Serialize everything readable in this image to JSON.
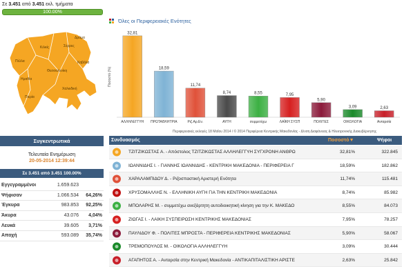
{
  "header": {
    "counted_prefix": "Σε",
    "counted": "3.451",
    "counted_mid": "από",
    "total": "3.451",
    "counted_suffix": "εκλ. τμήματα",
    "progress_label": "100.00%",
    "progress": 1.0
  },
  "map": {
    "labels": [
      "Σέρρες",
      "Κιλκίς",
      "Πέλλα",
      "Δράμα",
      "Θεσσαλονίκη",
      "Ημαθία",
      "Καβάλα",
      "Πιερία",
      "Χαλκιδική"
    ]
  },
  "chart": {
    "title": "Όλες οι Περιφερειακές Ενότητες",
    "footnote": "Περιφερειακές εκλογές 18 Μαΐου 2014 / © 2014 Περιφέρεια Κεντρικής Μακεδονίας - Δ/νση Διαφάνειας & Ηλεκτρονικής Διακυβέρνησης"
  },
  "chart_data": {
    "type": "bar",
    "ylabel": "Ποσοστό (%)",
    "categories": [
      "ΑΛΛΗΛΕΓΓΥΗ",
      "ΠΡΩΤΑΘΛΗΤΡΙΑ",
      "Ριζ.Αρ.Εν.",
      "ΑΥΓΗ",
      "συμμετέχω",
      "ΛΑΪΚΗ ΣΥΣΠ",
      "ΠΟΛΙΤΕΣ",
      "ΟΙΚΟΛΟΓΙΑ",
      "Ανταρσία"
    ],
    "values": [
      32.81,
      18.59,
      11.74,
      8.74,
      8.55,
      7.95,
      5.9,
      3.09,
      2.63
    ],
    "value_labels": [
      "32,81",
      "18,59",
      "11,74",
      "8,74",
      "8,55",
      "7,95",
      "5,90",
      "3,09",
      "2,63"
    ],
    "colors": [
      "#f5a623",
      "#7fb3d5",
      "#e0523a",
      "#4a4a4a",
      "#3cb043",
      "#d62020",
      "#8b1a3a",
      "#1a8a2a",
      "#c8202a"
    ],
    "ylim": [
      0,
      35
    ]
  },
  "summary": {
    "title": "Συγκεντρωτικά",
    "update_label": "Τελευταία Ενημέρωση",
    "update_time": "20-05-2014 12:39:44",
    "counted_bar": "Σε 3.451 από 3.451   100.00%",
    "rows": [
      {
        "label": "Εγγεγραμμένοι",
        "value": "1.659.623",
        "pct": ""
      },
      {
        "label": "Ψήφισαν",
        "value": "1.066.534",
        "pct": "64,26%"
      },
      {
        "label": "Έγκυρα",
        "value": "983.853",
        "pct": "92,25%"
      },
      {
        "label": "Άκυρα",
        "value": "43.076",
        "pct": "4,04%"
      },
      {
        "label": "Λευκά",
        "value": "39.605",
        "pct": "3,71%"
      },
      {
        "label": "Αποχή",
        "value": "593.089",
        "pct": "35,74%"
      }
    ]
  },
  "table": {
    "col_name": "Συνδυασμός",
    "col_pct": "Ποσοστό▼",
    "col_votes": "Ψήφοι",
    "rows": [
      {
        "name": "ΤΖΙΤΖΙΚΩΣΤΑΣ Α. - Απόστολος ΤΖΙΤΖΙΚΩΣΤΑΣ ΑΛΛΗΛΕΓΓΥΗ ΣΥΓΧΡΟΝΗ ΑΝΘΡΩ",
        "pct": "32,81%",
        "votes": "322.845",
        "logo": "#f5a623"
      },
      {
        "name": "ΙΩΑΝΝΙΔΗΣ Ι. - ΓΙΑΝΝΗΣ ΙΩΑΝΝΙΔΗΣ - ΚΕΝΤΡΙΚΗ ΜΑΚΕΔΟΝΙΑ - ΠΕΡΙΦΕΡΕΙΑ Γ",
        "pct": "18,59%",
        "votes": "182.862",
        "logo": "#7fb3d5"
      },
      {
        "name": "ΧΑΡΑΛΑΜΠΙΔΟΥ Δ. - Ριζοσπαστική Αριστερή Ενότητα",
        "pct": "11,74%",
        "votes": "115.481",
        "logo": "#e0523a"
      },
      {
        "name": "ΧΡΥΣΟΜΑΛΛΗΣ Ν. - ΕΛΛΗΝΙΚΗ ΑΥΓΗ ΓΙΑ ΤΗΝ ΚΕΝΤΡΙΚΗ ΜΑΚΕΔΟΝΙΑ",
        "pct": "8,74%",
        "votes": "85.982",
        "logo": "#c01010"
      },
      {
        "name": "ΜΠΟΛΑΡΗΣ Μ. - συμμετέχω ανεξάρτητη αυτοδιοικητική κίνηση για την Κ. ΜΑΚΕΔΟ",
        "pct": "8,55%",
        "votes": "84.073",
        "logo": "#3cb043"
      },
      {
        "name": "ΖΙΩΓΑΣ Ι. - ΛΑΪΚΗ ΣΥΣΠΕΙΡΩΣΗ ΚΕΝΤΡΙΚΗΣ ΜΑΚΕΔΟΝΙΑΣ",
        "pct": "7,95%",
        "votes": "78.257",
        "logo": "#d62020"
      },
      {
        "name": "ΠΑΥΛΙΔΟΥ Φ. - ΠΟΛΙΤΕΣ ΜΠΡΟΣΤΑ - ΠΕΡΙΦΕΡΕΙΑ ΚΕΝΤΡΙΚΗΣ ΜΑΚΕΔΟΝΙΑΣ",
        "pct": "5,90%",
        "votes": "58.067",
        "logo": "#8b1a3a"
      },
      {
        "name": "ΤΡΕΜΟΠΟΥΛΟΣ Μ. - ΟΙΚΟΛΟΓΙΑ ΑΛΛΗΛΕΓΓΥΗ",
        "pct": "3,09%",
        "votes": "30.444",
        "logo": "#1a8a2a"
      },
      {
        "name": "ΑΓΑΠΗΤΟΣ Α. - Ανταρσία στην Κεντρική Μακεδονία - ΑΝΤΙΚΑΠΙΤΑΛΙΣΤΙΚΗ ΑΡΙΣΤΕ",
        "pct": "2,63%",
        "votes": "25.842",
        "logo": "#c8202a"
      }
    ]
  }
}
